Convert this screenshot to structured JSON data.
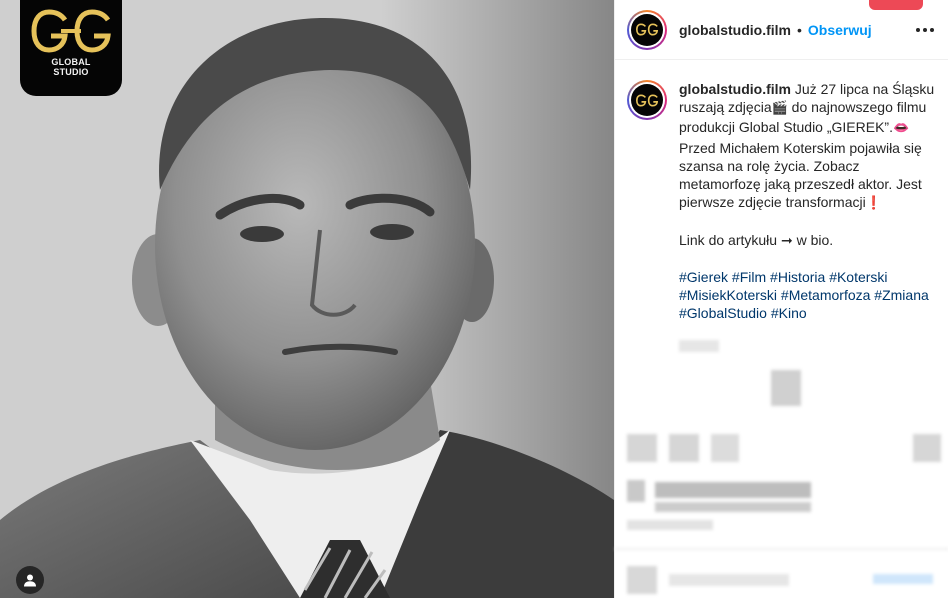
{
  "photo": {
    "brand_logo": {
      "line1": "GLOBAL",
      "line2": "STUDIO"
    }
  },
  "header": {
    "username": "globalstudio.film",
    "separator": "•",
    "follow_label": "Obserwuj"
  },
  "caption": {
    "username": "globalstudio.film",
    "segments": {
      "part1": "Już 27 lipca na Śląsku ruszają zdjęcia",
      "clapper": "🎬",
      "part2": " do najnowszego filmu produkcji Global Studio „GIEREK”.",
      "lips": "👄",
      "part3": " Przed Michałem Koterskim pojawiła się szansa na rolę życia. Zobacz metamorfozę jaką przeszedł aktor. Jest pierwsze zdjęcie transformacji",
      "exclaim": "❗"
    },
    "link_line": "Link do artykułu ➞ w bio.",
    "hashtags": [
      "#Gierek",
      "#Film",
      "#Historia",
      "#Koterski",
      "#MisiekKoterski",
      "#Metamorfoza",
      "#Zmiana",
      "#GlobalStudio",
      "#Kino"
    ]
  },
  "colors": {
    "accent_blue": "#0095f6",
    "hashtag_blue": "#00376b",
    "red_button": "#ed4956",
    "logo_gold": "#e6c25a"
  }
}
